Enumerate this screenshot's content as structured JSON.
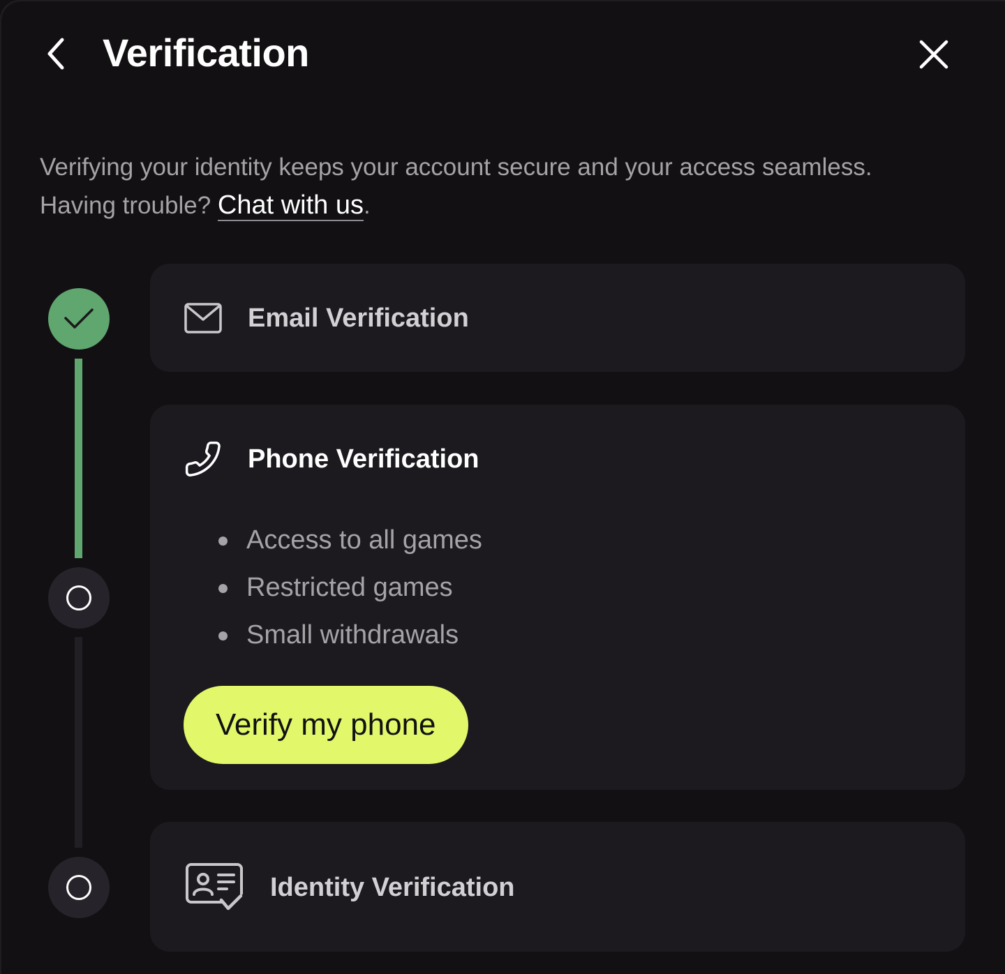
{
  "header": {
    "title": "Verification"
  },
  "description": {
    "line1": "Verifying your identity keeps your account secure and your access seamless.",
    "line2_prefix": "Having trouble? ",
    "link_label": "Chat with us",
    "line2_suffix": "."
  },
  "steps": [
    {
      "title": "Email Verification",
      "icon": "envelope-icon",
      "status": "completed"
    },
    {
      "title": "Phone Verification",
      "icon": "phone-icon",
      "status": "current",
      "benefits": [
        "Access to all games",
        "Restricted games",
        "Small withdrawals"
      ],
      "button_label": "Verify my phone"
    },
    {
      "title": "Identity Verification",
      "icon": "id-card-icon",
      "status": "pending"
    }
  ],
  "colors": {
    "background": "#131013",
    "card": "#1c1a1f",
    "success": "#5fa66f",
    "accent": "#e2f86a",
    "muted_text": "#a5a3a6"
  }
}
